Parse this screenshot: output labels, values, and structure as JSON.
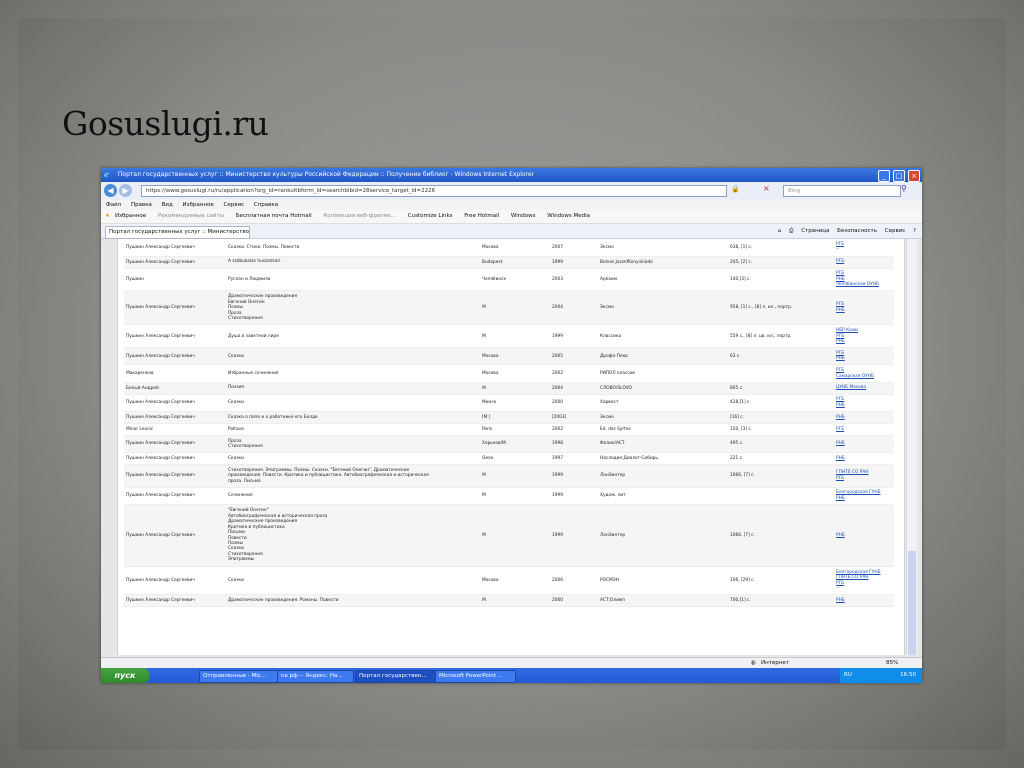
{
  "slide": {
    "title": "Gosuslugi.ru"
  },
  "window": {
    "title": "Портал государственных услуг :: Министерство культуры Российской Федерации :: Получение библиог - Windows Internet Explorer"
  },
  "address": {
    "url": "https://www.gosuslugi.ru/ru/application?org_id=rankultbform_id=searchbibid=28service_target_id=2226",
    "search_placeholder": "Bing"
  },
  "menu": [
    "Файл",
    "Правка",
    "Вид",
    "Избранное",
    "Сервис",
    "Справка"
  ],
  "favorites": [
    "Избранное",
    "Рекомендуемые сайты",
    "Бесплатная почта Hotmail",
    "Коллекция веб-фрагме...",
    "Customize Links",
    "Free Hotmail",
    "Windows",
    "Windows Media"
  ],
  "tab": {
    "label": "Портал государственных услуг :: Министерство к..."
  },
  "toolbar": [
    "Страница",
    "Безопасность",
    "Сервис"
  ],
  "rows": [
    {
      "author": "Пушкин Александр Сергеевич",
      "title": [
        "Сказки. Стихи. Поэмы. Повести"
      ],
      "place": "Москва",
      "year": "2007",
      "publisher": "Эксмо",
      "pages": "638, [1] с.",
      "libs": [
        "РГБ",
        "--"
      ]
    },
    {
      "author": "Пушкин Александр Сергеевич",
      "title": [
        "A szóbukalás huszadsári"
      ],
      "place": "Budapest",
      "year": "1999",
      "publisher": "Bolvos JozsefKonyvkiado",
      "pages": "205, [2] с.",
      "libs": [
        "РГБ"
      ]
    },
    {
      "author": "Пушкин",
      "title": [
        "Руслан и Людмила"
      ],
      "place": "Челябинск",
      "year": "2003",
      "publisher": "Аркаим",
      "pages": "140,[3] с.",
      "libs": [
        "РГБ",
        "РНБ",
        "Челябинская ОУНБ"
      ]
    },
    {
      "author": "Пушкин Александр Сергеевич",
      "title": [
        "Драматические произведения",
        "Евгений Онегин",
        "Поэмы",
        "Проза",
        "Стихотворения"
      ],
      "place": "М.",
      "year": "2004",
      "publisher": "Эксмо",
      "pages": "958, [1] с., [8] л. ил., портр.",
      "libs": [
        "РГБ",
        "РНБ"
      ]
    },
    {
      "author": "Пушкин Александр Сергеевич",
      "title": [
        "Душа в заветной лире"
      ],
      "place": "М.",
      "year": "1999",
      "publisher": "Классика",
      "pages": "559 с., [8] л. цв. ил., портр.",
      "libs": [
        "НБР Коми",
        "РГБ",
        "РНБ"
      ]
    },
    {
      "author": "Пушкин Александр Сергеевич",
      "title": [
        "Сказки"
      ],
      "place": "Москва",
      "year": "2005",
      "publisher": "Дрофа-Плюс",
      "pages": "63 с.",
      "libs": [
        "РГБ",
        "РНБ"
      ]
    },
    {
      "author": "Макаренков",
      "title": [
        "Избранные сочинения"
      ],
      "place": "Москва",
      "year": "2002",
      "publisher": "РИПОЛ классик",
      "pages": "",
      "libs": [
        "РГБ",
        "Самарская ОУНБ"
      ]
    },
    {
      "author": "Белый Андрей",
      "title": [
        "Поэзия"
      ],
      "place": "М.",
      "year": "2004",
      "publisher": "СЛОВО/SLOVO",
      "pages": "805 с.",
      "libs": [
        "ЦУНБ Москва"
      ]
    },
    {
      "author": "Пушкин Александр Сергеевич",
      "title": [
        "Сказки"
      ],
      "place": "Минск",
      "year": "2000",
      "publisher": "Харвест",
      "pages": "428,[1] с.",
      "libs": [
        "РГБ",
        "РНБ"
      ]
    },
    {
      "author": "Пушкин Александр Сергеевич",
      "title": [
        "Сказка о попе и о работнике его Балде"
      ],
      "place": "[М.]",
      "year": "[2003]",
      "publisher": "Эксмо",
      "pages": "[16] с.",
      "libs": [
        "РНБ"
      ]
    },
    {
      "author": "Minor Leonic",
      "title": [
        "Poltava"
      ],
      "place": "Paris",
      "year": "2002",
      "publisher": "Ed. des Syrtes",
      "pages": "150, [3] с.",
      "libs": [
        "РГБ"
      ]
    },
    {
      "author": "Пушкин Александр Сергеевич",
      "title": [
        "Проза",
        "Стихотворения"
      ],
      "place": "Харьков/М.",
      "year": "1998",
      "publisher": "Фолио/АСТ",
      "pages": "495 с.",
      "libs": [
        "РНБ"
      ]
    },
    {
      "author": "Пушкин Александр Сергеевич",
      "title": [
        "Сказки"
      ],
      "place": "Омск",
      "year": "1997",
      "publisher": "Наследие;Диалог-Сибирь",
      "pages": "221 с.",
      "libs": [
        "РНБ"
      ]
    },
    {
      "author": "Пушкин Александр Сергеевич",
      "title": [
        "Стихотворения. Эпиграммы. Поэмы. Сказки. \"Евгений Онегин\". Драматические",
        "произведения. Повести. Критика и публицистика. Автобиографическая и историческая",
        "проза. Письма"
      ],
      "place": "М.",
      "year": "1999",
      "publisher": "ЛанЭинтер",
      "pages": "1066, [7] с.",
      "libs": [
        "ГПНТБ СО РАН",
        "РГБ"
      ]
    },
    {
      "author": "Пушкин Александр Сергеевич",
      "title": [
        "Сочинения"
      ],
      "place": "М.",
      "year": "1999",
      "publisher": "Худож. лит",
      "pages": "",
      "libs": [
        "Белгородская ГУНБ",
        "РНБ"
      ]
    },
    {
      "author": "Пушкин Александр Сергеевич",
      "title": [
        "\"Евгений Онегин\"",
        "Автобиографическая и историческая проза",
        "Драматические произведения",
        "Критика и публицистика",
        "Письма",
        "Повести",
        "Поэмы",
        "Сказки",
        "Стихотворения",
        "Эпиграммы"
      ],
      "place": "М.",
      "year": "1999",
      "publisher": "ЛанЭинтер",
      "pages": "1066, [7] с.",
      "libs": [
        "РНБ"
      ]
    },
    {
      "author": "Пушкин Александр Сергеевич",
      "title": [
        "Сказки"
      ],
      "place": "Москва",
      "year": "2006",
      "publisher": "РОСМЭН",
      "pages": "106, [29] с.",
      "libs": [
        "Белгородская ГУНБ",
        "ГПНТБ СО РАН",
        "РГБ",
        "--"
      ]
    },
    {
      "author": "Пушкин Александр Сергеевич",
      "title": [
        "Драматические произведения. Романы. Повести"
      ],
      "place": "М.",
      "year": "2000",
      "publisher": "АСТ;Олимп",
      "pages": "700,[1] с.",
      "libs": [
        "РНБ"
      ]
    }
  ],
  "status": {
    "zone": "Интернет",
    "zoom": "85%"
  },
  "taskbar": {
    "start": "пуск",
    "items": [
      "Отправленные - Mic...",
      "ne рф -- Яндекс: На...",
      "Портал государствен...",
      "Microsoft PowerPoint ..."
    ],
    "lang": "RU",
    "time": "16:50"
  }
}
